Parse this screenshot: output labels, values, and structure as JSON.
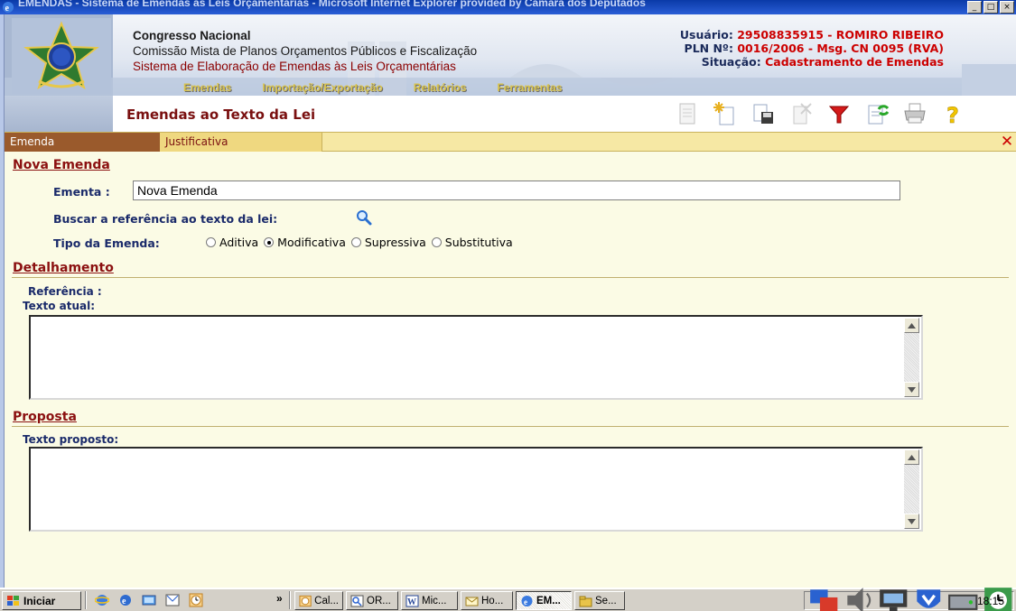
{
  "window": {
    "title": "EMENDAS - Sistema de Emendas às Leis Orçamentárias - Microsoft Internet Explorer provided by Câmara dos Deputados",
    "buttons": [
      "_",
      "□",
      "×"
    ]
  },
  "header": {
    "org_name": "Congresso Nacional",
    "commission": "Comissão Mista de Planos Orçamentos Públicos e Fiscalização",
    "system": "Sistema de Elaboração de Emendas às Leis Orçamentárias",
    "user_label": "Usuário:",
    "user_value": "29508835915 - ROMIRO RIBEIRO",
    "pln_label": "PLN Nº:",
    "pln_value": "0016/2006 - Msg. CN 0095 (RVA)",
    "situation_label": "Situação:",
    "situation_value": "Cadastramento de Emendas",
    "menu": [
      "Emendas",
      "Importação/Exportação",
      "Relatórios",
      "Ferramentas"
    ]
  },
  "page": {
    "title": "Emendas ao Texto da Lei"
  },
  "toolbar": [
    "document-icon",
    "new-icon",
    "save-icon",
    "delete-icon",
    "filter-icon",
    "refresh-icon",
    "print-icon",
    "help-icon"
  ],
  "tabs": {
    "active": "Emenda",
    "inactive": "Justificativa",
    "close": "✕"
  },
  "form": {
    "section_new": "Nova Emenda",
    "ementa_label": "Ementa :",
    "ementa_value": "Nova Emenda",
    "search_label": "Buscar a referência ao texto da lei:",
    "tipo_label": "Tipo da Emenda:",
    "tipo_options": [
      {
        "label": "Aditiva",
        "selected": false
      },
      {
        "label": "Modificativa",
        "selected": true
      },
      {
        "label": "Supressiva",
        "selected": false
      },
      {
        "label": "Substitutiva",
        "selected": false
      }
    ],
    "section_detail": "Detalhamento",
    "referencia_label": "Referência :",
    "texto_atual_label": "Texto atual:",
    "texto_atual_value": "",
    "section_proposal": "Proposta",
    "texto_proposto_label": "Texto proposto:",
    "texto_proposto_value": ""
  },
  "taskbar": {
    "start_label": "Iniciar",
    "chevron": "»",
    "tasks": [
      {
        "label": "Cal...",
        "pressed": false
      },
      {
        "label": "OR...",
        "pressed": false
      },
      {
        "label": "Mic...",
        "pressed": false
      },
      {
        "label": "Ho...",
        "pressed": false
      },
      {
        "label": "EM...",
        "pressed": true
      },
      {
        "label": "Se...",
        "pressed": false
      }
    ],
    "clock": "18:15"
  },
  "colors": {
    "accent_red": "#8b1010",
    "tab_active": "#9a5a2c",
    "form_bg": "#fbfbe5",
    "menu_gold": "#d9c34c"
  }
}
